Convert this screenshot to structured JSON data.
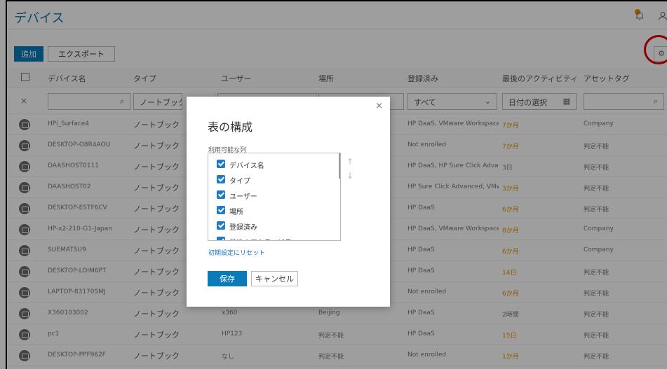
{
  "page": {
    "title": "デバイス"
  },
  "toolbar": {
    "add_label": "追加",
    "export_label": "エクスポート"
  },
  "table": {
    "headers": [
      "デバイス名",
      "タイプ",
      "ユーザー",
      "場所",
      "登録済み",
      "最後のアクティビティ",
      "アセットタグ"
    ],
    "filters": {
      "type_value": "ノートブック",
      "enrolled_value": "すべて",
      "date_placeholder": "日付の選択"
    },
    "rows": [
      {
        "name": "HPi_Surface4",
        "type": "ノートブック",
        "user": "",
        "location": "",
        "enrolled": "HP DaaS, VMware Workspace ONE",
        "activity": "7か月",
        "activity_color": "orange",
        "asset": "Company"
      },
      {
        "name": "DESKTOP-O8R4AOU",
        "type": "ノートブック",
        "user": "",
        "location": "",
        "enrolled": "Not enrolled",
        "activity": "7か月",
        "activity_color": "orange",
        "asset": "判定不能"
      },
      {
        "name": "DAASHOST0111",
        "type": "ノートブック",
        "user": "",
        "location": "",
        "enrolled": "HP DaaS, HP Sure Click Advanced",
        "activity": "3日",
        "activity_color": "normal",
        "asset": "判定不能"
      },
      {
        "name": "DAASHOST02",
        "type": "ノートブック",
        "user": "",
        "location": "",
        "enrolled": "HP Sure Click Advanced, VMware ...",
        "activity": "3か月",
        "activity_color": "orange",
        "asset": "判定不能"
      },
      {
        "name": "DESKTOP-ESTF6CV",
        "type": "ノートブック",
        "user": "",
        "location": "",
        "enrolled": "HP DaaS",
        "activity": "6か月",
        "activity_color": "orange",
        "asset": "判定不能"
      },
      {
        "name": "HP-x2-210-G1-Japan",
        "type": "ノートブック",
        "user": "",
        "location": "",
        "enrolled": "HP DaaS, VMware Workspace ONE",
        "activity": "8か月",
        "activity_color": "orange",
        "asset": "Company"
      },
      {
        "name": "SUEMATSU9",
        "type": "ノートブック",
        "user": "",
        "location": "",
        "enrolled": "HP DaaS",
        "activity": "6か月",
        "activity_color": "orange",
        "asset": "Company"
      },
      {
        "name": "DESKTOP-LOIM6PT",
        "type": "ノートブック",
        "user": "",
        "location": "",
        "enrolled": "HP DaaS",
        "activity": "14日",
        "activity_color": "orange",
        "asset": "判定不能"
      },
      {
        "name": "LAPTOP-83170SMJ",
        "type": "ノートブック",
        "user": "",
        "location": "",
        "enrolled": "Not enrolled",
        "activity": "6か月",
        "activity_color": "orange",
        "asset": "判定不能"
      },
      {
        "name": "X360103002",
        "type": "ノートブック",
        "user": "x360",
        "location": "Beijing",
        "enrolled": "HP DaaS",
        "activity": "2時間",
        "activity_color": "normal",
        "asset": "判定不能"
      },
      {
        "name": "pc1",
        "type": "ノートブック",
        "user": "HP123",
        "location": "判定不能",
        "enrolled": "HP DaaS",
        "activity": "15日",
        "activity_color": "orange",
        "asset": "判定不能"
      },
      {
        "name": "DESKTOP-PPF962F",
        "type": "ノートブック",
        "user": "なし",
        "location": "判定不能",
        "enrolled": "Not enrolled",
        "activity": "1か月",
        "activity_color": "orange",
        "asset": "判定不能"
      }
    ]
  },
  "modal": {
    "title": "表の構成",
    "available_label": "利用可能な列",
    "columns": [
      "デバイス名",
      "タイプ",
      "ユーザー",
      "場所",
      "登録済み",
      "最後のアクティビティ"
    ],
    "reset_label": "初期設定にリセット",
    "save_label": "保存",
    "cancel_label": "キャンセル"
  },
  "colors": {
    "accent": "#0a7ab8",
    "orange": "#e88d00",
    "highlight_ring": "#e10000"
  },
  "icons": [
    "bell-icon",
    "user-icon",
    "gear-icon",
    "search-icon",
    "chevron-down-icon",
    "calendar-icon",
    "close-icon",
    "device-icon"
  ]
}
